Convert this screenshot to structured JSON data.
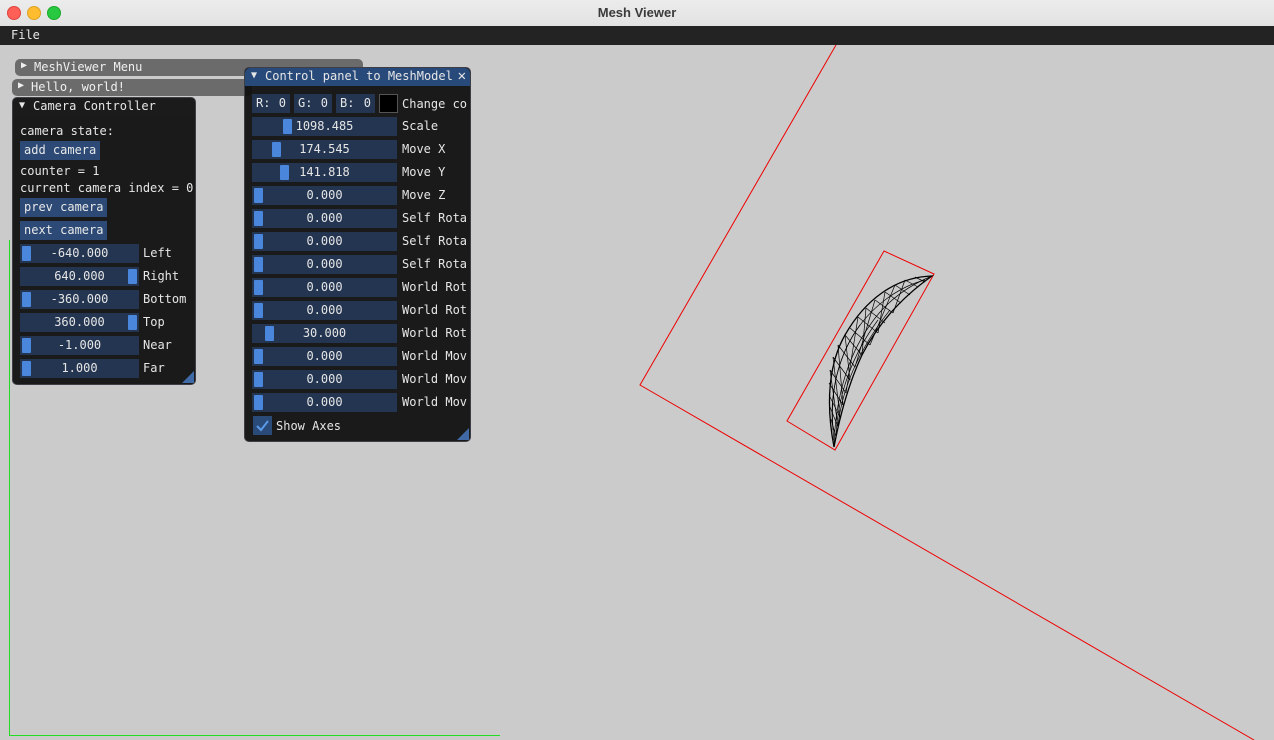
{
  "window": {
    "title": "Mesh Viewer"
  },
  "menubar": {
    "file": "File"
  },
  "collapsed": {
    "meshviewer_menu": "MeshViewer Menu",
    "hello": "Hello, world!"
  },
  "camera_controller": {
    "title": "Camera Controller",
    "state_label": "camera state:",
    "add_camera": "add camera",
    "counter": "counter = 1",
    "index": "current camera index = 0",
    "prev": "prev camera",
    "next": "next camera",
    "sliders": [
      {
        "value": "-640.000",
        "label": "Left",
        "fraction": 0.0
      },
      {
        "value": "640.000",
        "label": "Right",
        "fraction": 1.0
      },
      {
        "value": "-360.000",
        "label": "Bottom",
        "fraction": 0.0
      },
      {
        "value": "360.000",
        "label": "Top",
        "fraction": 1.0
      },
      {
        "value": "-1.000",
        "label": "Near",
        "fraction": 0.0
      },
      {
        "value": "1.000",
        "label": "Far",
        "fraction": 0.0
      }
    ]
  },
  "control_panel": {
    "title": "Control panel to MeshModel",
    "close_icon": "close-icon",
    "color": {
      "r_label": "R:",
      "r": "0",
      "g_label": "G:",
      "g": "0",
      "b_label": "B:",
      "b": "0",
      "swatch": "#000000",
      "label": "Change co"
    },
    "sliders": [
      {
        "value": "1098.485",
        "label": "Scale",
        "fraction": 0.22
      },
      {
        "value": "174.545",
        "label": "Move X",
        "fraction": 0.14
      },
      {
        "value": "141.818",
        "label": "Move Y",
        "fraction": 0.2
      },
      {
        "value": "0.000",
        "label": "Move Z",
        "fraction": 0.0
      },
      {
        "value": "0.000",
        "label": "Self Rota",
        "fraction": 0.0
      },
      {
        "value": "0.000",
        "label": "Self Rota",
        "fraction": 0.0
      },
      {
        "value": "0.000",
        "label": "Self Rota",
        "fraction": 0.0
      },
      {
        "value": "0.000",
        "label": "World Rot",
        "fraction": 0.0
      },
      {
        "value": "0.000",
        "label": "World Rot",
        "fraction": 0.0
      },
      {
        "value": "30.000",
        "label": "World Rot",
        "fraction": 0.08
      },
      {
        "value": "0.000",
        "label": "World Mov",
        "fraction": 0.0
      },
      {
        "value": "0.000",
        "label": "World Mov",
        "fraction": 0.0
      },
      {
        "value": "0.000",
        "label": "World Mov",
        "fraction": 0.0
      }
    ],
    "show_axes": {
      "label": "Show Axes",
      "checked": true
    }
  },
  "colors": {
    "accent": "#4a86dc",
    "frame": "#233550",
    "title_active": "#284a7a",
    "axis_x": "#ff0000",
    "axis_y": "#00dd00"
  }
}
